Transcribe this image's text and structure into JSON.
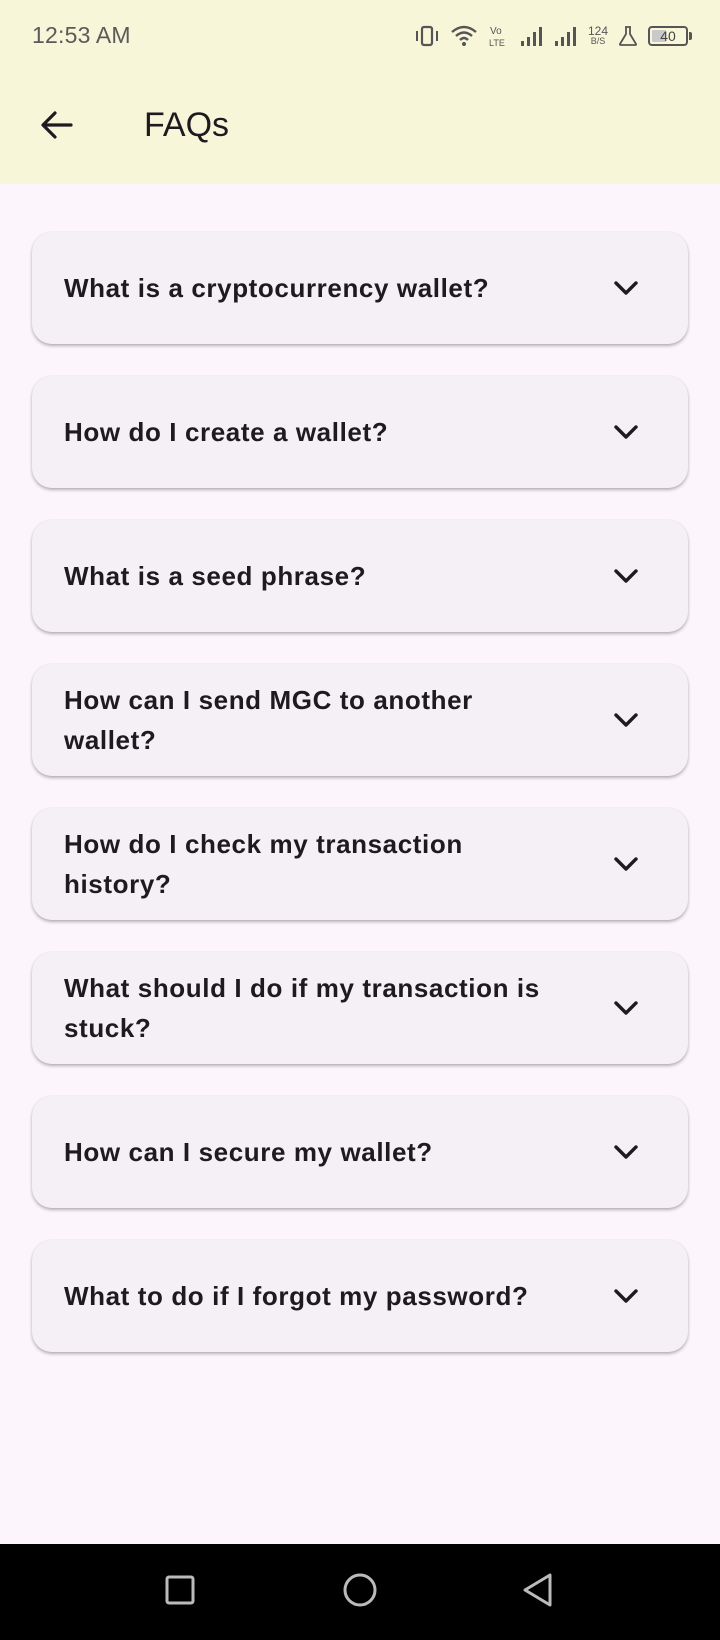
{
  "status_bar": {
    "time": "12:53 AM",
    "network_speed_value": "124",
    "network_speed_unit": "B/S",
    "battery_percent": "40",
    "icons": [
      "vibrate-icon",
      "wifi-icon",
      "volte-icon",
      "signal-icon",
      "signal-icon",
      "flask-icon",
      "battery-icon"
    ]
  },
  "app_bar": {
    "title": "FAQs",
    "back_icon": "arrow-left-icon"
  },
  "faqs": [
    {
      "question": "What is a cryptocurrency wallet?"
    },
    {
      "question": "How do I create a wallet?"
    },
    {
      "question": "What is a seed phrase?"
    },
    {
      "question": "How can I send MGC to another wallet?"
    },
    {
      "question": "How do I check my transaction history?"
    },
    {
      "question": "What should I do if my transaction is stuck?"
    },
    {
      "question": "How can I secure my wallet?"
    },
    {
      "question": "What to do if I forgot my password?"
    }
  ],
  "nav_bar": {
    "buttons": [
      "recents-square-icon",
      "home-circle-icon",
      "back-triangle-icon"
    ]
  },
  "colors": {
    "app_bar_bg": "#f8f6d9",
    "page_bg": "#fcf6fc",
    "card_bg": "#f5eff6",
    "text": "#1d1b20"
  }
}
